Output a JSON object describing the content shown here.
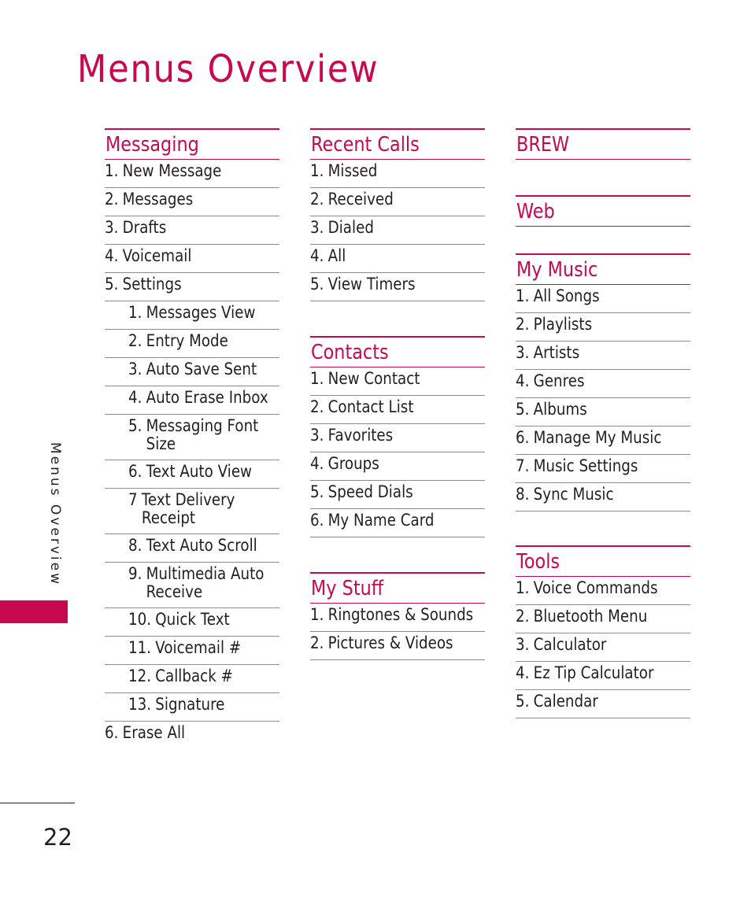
{
  "page": {
    "title": "Menus Overview",
    "side_label": "Menus Overview",
    "page_number": "22",
    "accent_color": "#c8094f"
  },
  "columns": [
    {
      "sections": [
        {
          "title": "Messaging",
          "items": [
            {
              "num": "1.",
              "text": "New Message",
              "level": 0
            },
            {
              "num": "2.",
              "text": "Messages",
              "level": 0
            },
            {
              "num": "3.",
              "text": "Drafts",
              "level": 0
            },
            {
              "num": "4.",
              "text": "Voicemail",
              "level": 0
            },
            {
              "num": "5.",
              "text": "Settings",
              "level": 0
            },
            {
              "num": "1.",
              "text": "Messages View",
              "level": 1
            },
            {
              "num": "2.",
              "text": "Entry Mode",
              "level": 1
            },
            {
              "num": "3.",
              "text": "Auto Save Sent",
              "level": 1
            },
            {
              "num": "4.",
              "text": "Auto Erase Inbox",
              "level": 1
            },
            {
              "num": "5.",
              "text": "Messaging Font Size",
              "level": 1
            },
            {
              "num": "6.",
              "text": "Text Auto View",
              "level": 1
            },
            {
              "num": "7",
              "text": "Text Delivery Receipt",
              "level": 1
            },
            {
              "num": "8.",
              "text": "Text Auto Scroll",
              "level": 1
            },
            {
              "num": "9.",
              "text": "Multimedia Auto Receive",
              "level": 1
            },
            {
              "num": "10.",
              "text": "Quick Text",
              "level": 1
            },
            {
              "num": "11.",
              "text": "Voicemail #",
              "level": 1
            },
            {
              "num": "12.",
              "text": "Callback #",
              "level": 1
            },
            {
              "num": "13.",
              "text": "Signature",
              "level": 1
            },
            {
              "num": "6.",
              "text": "Erase All",
              "level": 0
            }
          ]
        }
      ]
    },
    {
      "sections": [
        {
          "title": "Recent Calls",
          "items": [
            {
              "num": "1.",
              "text": "Missed",
              "level": 0
            },
            {
              "num": "2.",
              "text": "Received",
              "level": 0
            },
            {
              "num": "3.",
              "text": "Dialed",
              "level": 0
            },
            {
              "num": "4.",
              "text": "All",
              "level": 0
            },
            {
              "num": "5.",
              "text": "View Timers",
              "level": 0
            }
          ]
        },
        {
          "title": "Contacts",
          "items": [
            {
              "num": "1.",
              "text": "New Contact",
              "level": 0
            },
            {
              "num": "2.",
              "text": "Contact List",
              "level": 0
            },
            {
              "num": "3.",
              "text": "Favorites",
              "level": 0
            },
            {
              "num": "4.",
              "text": "Groups",
              "level": 0
            },
            {
              "num": "5.",
              "text": "Speed Dials",
              "level": 0
            },
            {
              "num": "6.",
              "text": "My Name Card",
              "level": 0
            }
          ]
        },
        {
          "title": "My Stuff",
          "items": [
            {
              "num": "1.",
              "text": "Ringtones & Sounds",
              "level": 0
            },
            {
              "num": "2.",
              "text": "Pictures & Videos",
              "level": 0
            }
          ]
        }
      ]
    },
    {
      "sections": [
        {
          "title": "BREW",
          "items": []
        },
        {
          "title": "Web",
          "items": []
        },
        {
          "title": "My Music",
          "items": [
            {
              "num": "1.",
              "text": "All Songs",
              "level": 0
            },
            {
              "num": "2.",
              "text": "Playlists",
              "level": 0
            },
            {
              "num": "3.",
              "text": "Artists",
              "level": 0
            },
            {
              "num": "4.",
              "text": "Genres",
              "level": 0
            },
            {
              "num": "5.",
              "text": "Albums",
              "level": 0
            },
            {
              "num": "6.",
              "text": "Manage My Music",
              "level": 0
            },
            {
              "num": "7.",
              "text": "Music Settings",
              "level": 0
            },
            {
              "num": "8.",
              "text": "Sync Music",
              "level": 0
            }
          ]
        },
        {
          "title": "Tools",
          "items": [
            {
              "num": "1.",
              "text": "Voice Commands",
              "level": 0
            },
            {
              "num": "2.",
              "text": "Bluetooth Menu",
              "level": 0
            },
            {
              "num": "3.",
              "text": "Calculator",
              "level": 0
            },
            {
              "num": "4.",
              "text": "Ez Tip Calculator",
              "level": 0
            },
            {
              "num": "5.",
              "text": "Calendar",
              "level": 0
            }
          ]
        }
      ]
    }
  ]
}
